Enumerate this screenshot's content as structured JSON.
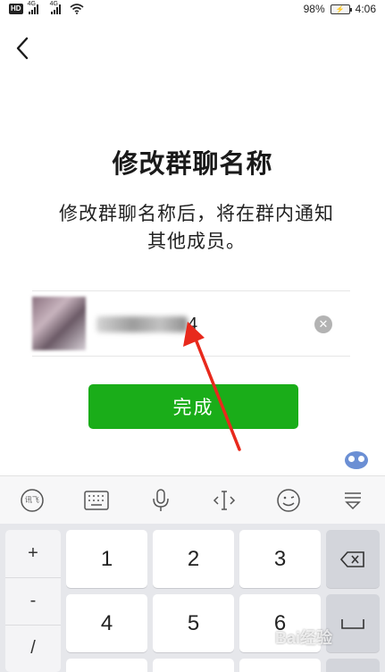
{
  "status_bar": {
    "hd": "HD",
    "signal1_label": "4G",
    "signal2_label": "4G",
    "battery_text": "98%",
    "time": "4:06"
  },
  "page": {
    "title": "修改群聊名称",
    "description_line1": "修改群聊名称后，将在群内通知",
    "description_line2": "其他成员。"
  },
  "name_field": {
    "value": "4",
    "clear_symbol": "✕"
  },
  "done_button": {
    "label": "完成"
  },
  "keyboard": {
    "toolbar": [
      "voice-input-brand-icon",
      "keyboard-icon",
      "microphone-icon",
      "cursor-icon",
      "emoji-icon",
      "collapse-icon"
    ],
    "side_keys": [
      "+",
      "-",
      "/"
    ],
    "digits_row1": [
      "1",
      "2",
      "3"
    ],
    "digits_row2": [
      "4",
      "5",
      "6"
    ],
    "brand_label": "讯飞"
  },
  "watermark": "Bai经验"
}
